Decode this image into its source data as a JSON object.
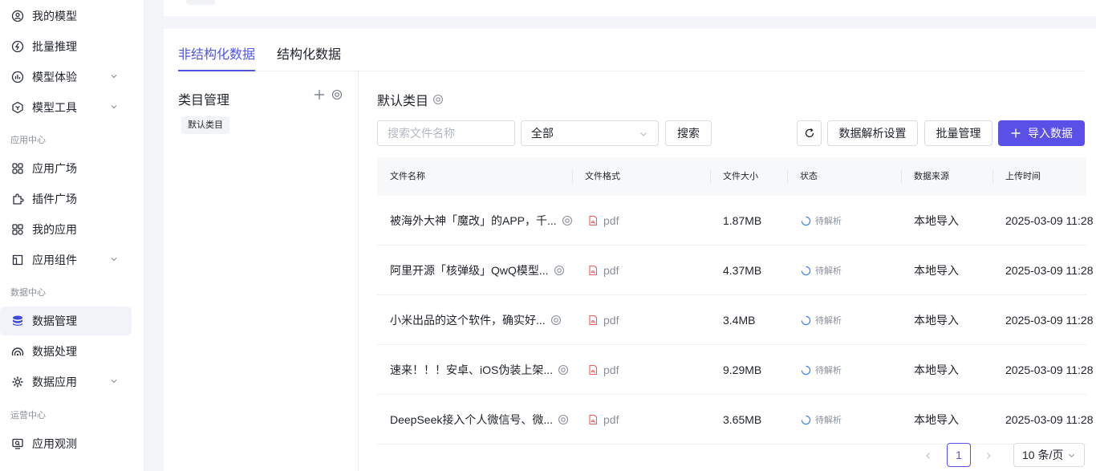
{
  "sidebar": {
    "items": [
      {
        "label": "我的模型",
        "icon": "model-icon"
      },
      {
        "label": "批量推理",
        "icon": "batch-inference-icon"
      },
      {
        "label": "模型体验",
        "icon": "experience-icon",
        "expandable": true
      },
      {
        "label": "模型工具",
        "icon": "tool-icon",
        "expandable": true
      },
      {
        "label": "应用广场",
        "icon": "app-square-icon"
      },
      {
        "label": "插件广场",
        "icon": "plugin-icon"
      },
      {
        "label": "我的应用",
        "icon": "my-apps-icon"
      },
      {
        "label": "应用组件",
        "icon": "component-icon",
        "expandable": true
      },
      {
        "label": "数据管理",
        "icon": "database-icon",
        "active": true
      },
      {
        "label": "数据处理",
        "icon": "data-processing-icon"
      },
      {
        "label": "数据应用",
        "icon": "data-app-icon",
        "expandable": true
      },
      {
        "label": "应用观测",
        "icon": "observe-icon"
      }
    ],
    "sections": [
      "应用中心",
      "数据中心",
      "运营中心"
    ]
  },
  "tabs": [
    {
      "label": "非结构化数据",
      "active": true
    },
    {
      "label": "结构化数据",
      "active": false
    }
  ],
  "category": {
    "title": "类目管理",
    "chip": "默认类目"
  },
  "content": {
    "title": "默认类目",
    "search_placeholder": "搜索文件名称",
    "filter_value": "全部",
    "search_button": "搜索",
    "parse_settings_button": "数据解析设置",
    "batch_button": "批量管理",
    "import_button": "导入数据"
  },
  "table": {
    "headers": [
      "文件名称",
      "文件格式",
      "文件大小",
      "状态",
      "数据来源",
      "上传时间"
    ],
    "rows": [
      {
        "name": "被海外大神「魔改」的APP，千...",
        "format": "pdf",
        "size": "1.87MB",
        "status": "待解析",
        "source": "本地导入",
        "time": "2025-03-09 11:28"
      },
      {
        "name": "阿里开源「核弹级」QwQ模型...",
        "format": "pdf",
        "size": "4.37MB",
        "status": "待解析",
        "source": "本地导入",
        "time": "2025-03-09 11:28"
      },
      {
        "name": "小米出品的这个软件，确实好...",
        "format": "pdf",
        "size": "3.4MB",
        "status": "待解析",
        "source": "本地导入",
        "time": "2025-03-09 11:28"
      },
      {
        "name": "速来！！！安卓、iOS伪装上架...",
        "format": "pdf",
        "size": "9.29MB",
        "status": "待解析",
        "source": "本地导入",
        "time": "2025-03-09 11:28"
      },
      {
        "name": "DeepSeek接入个人微信号、微...",
        "format": "pdf",
        "size": "3.65MB",
        "status": "待解析",
        "source": "本地导入",
        "time": "2025-03-09 11:28"
      }
    ]
  },
  "pagination": {
    "current_page": "1",
    "page_size": "10 条/页"
  },
  "colors": {
    "accent": "#5a4fe6",
    "tab_active": "#4f56e0",
    "pdf_icon": "#ef5a5a",
    "status_icon": "#3b82f6"
  }
}
